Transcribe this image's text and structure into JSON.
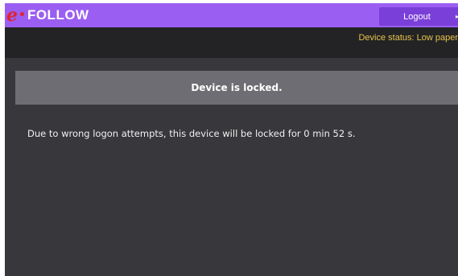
{
  "header": {
    "logo_mark": "e",
    "logo_text": "FOLLOW",
    "logout_label": "Logout"
  },
  "status": {
    "text": "Device status: Low paper"
  },
  "lock": {
    "title": "Device is locked.",
    "message": "Due to wrong logon attempts, this device will be locked for 0 min 52 s."
  },
  "colors": {
    "header_bg": "#9b5ef2",
    "logout_bg": "#7b3fd9",
    "status_text": "#e7c24a",
    "banner_bg": "#6d6d73",
    "page_bg": "#38383c"
  }
}
